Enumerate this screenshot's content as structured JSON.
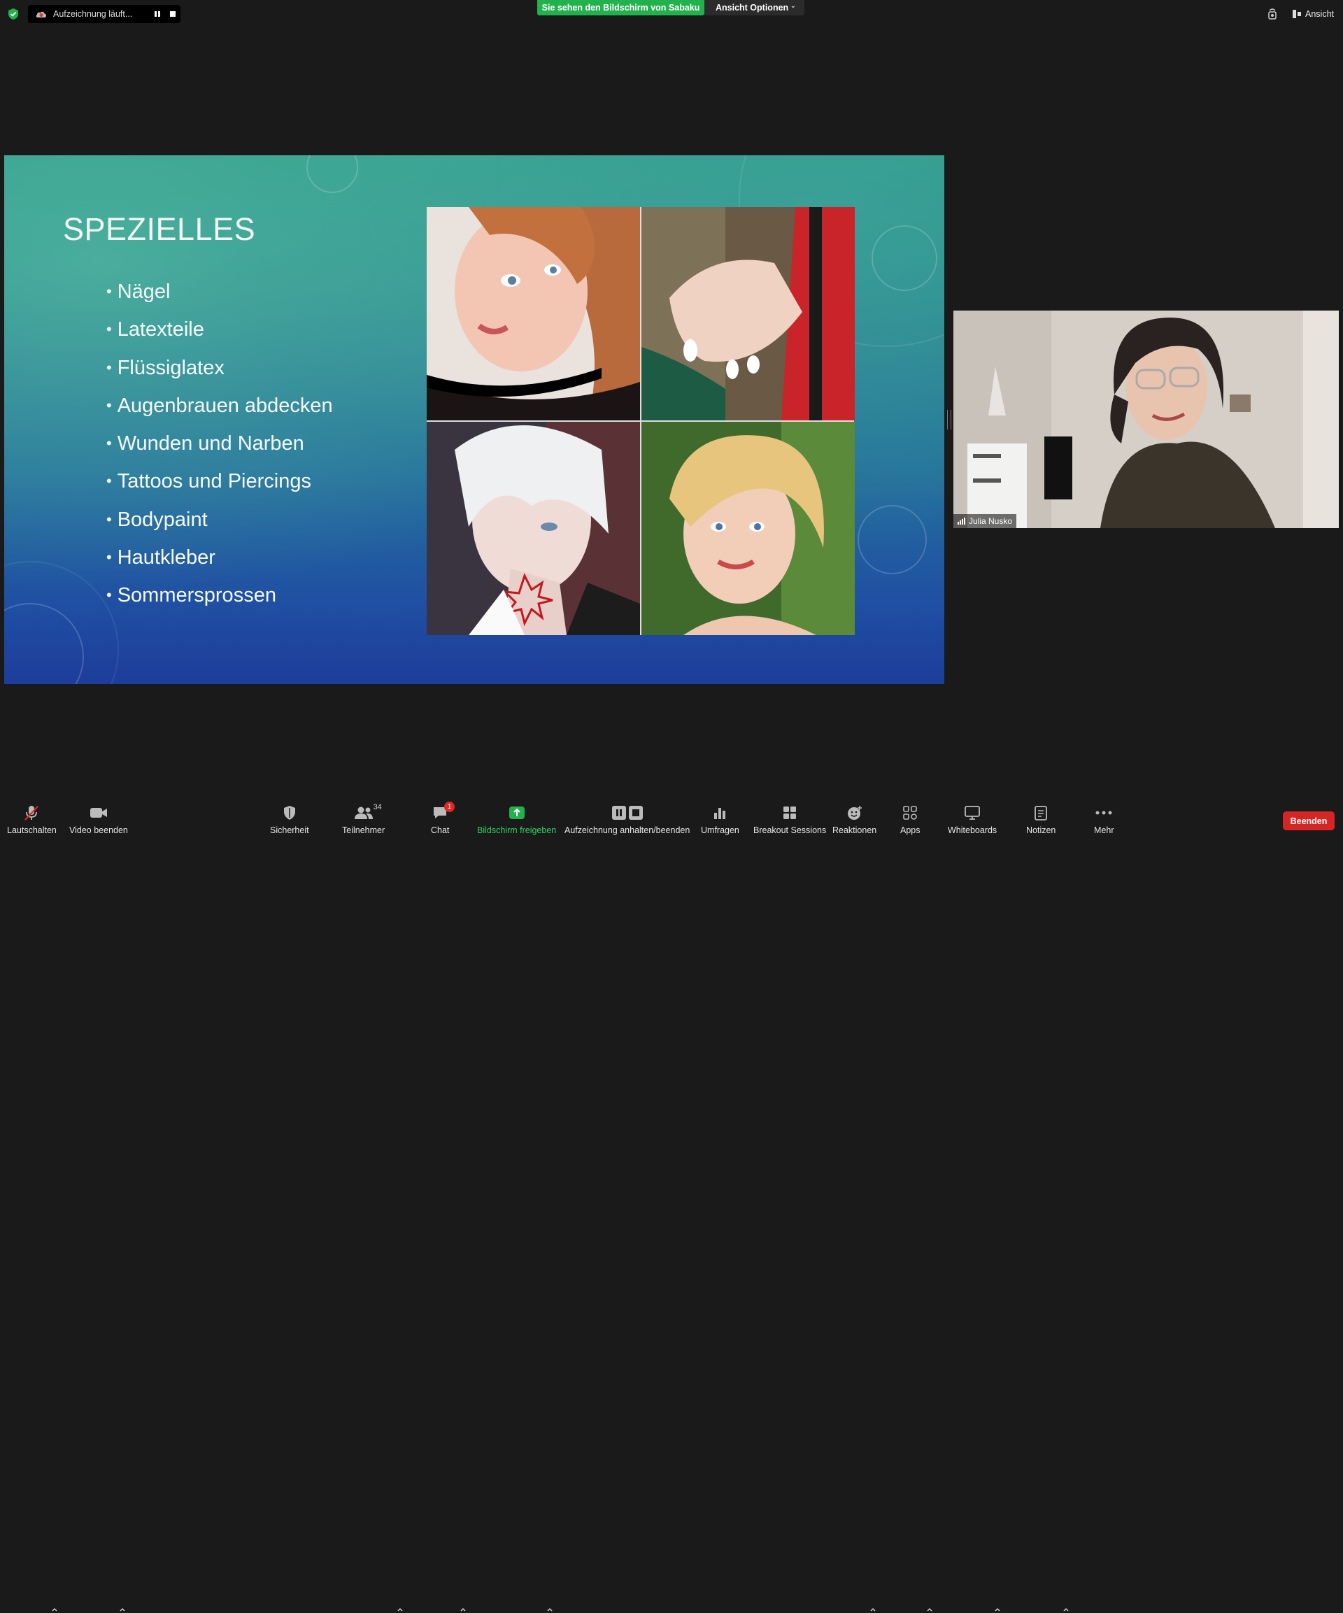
{
  "top_bar": {
    "recording_status": "Aufzeichnung läuft...",
    "viewing_banner": "Sie sehen den Bildschirm von Sabaku",
    "view_options_label": "Ansicht Optionen",
    "view_label": "Ansicht"
  },
  "slide": {
    "title": "SPEZIELLES",
    "bullets": [
      "Nägel",
      "Latexteile",
      "Flüssiglatex",
      "Augenbrauen abdecken",
      "Wunden und Narben",
      "Tattoos und Piercings",
      "Bodypaint",
      "Hautkleber",
      "Sommersprossen"
    ]
  },
  "participant_video": {
    "name": "Julia Nusko"
  },
  "toolbar": {
    "mute_label": "Lautschalten",
    "video_label": "Video beenden",
    "security_label": "Sicherheit",
    "participants_label": "Teilnehmer",
    "participants_count": "34",
    "chat_label": "Chat",
    "chat_badge": "1",
    "share_label": "Bildschirm freigeben",
    "recording_label": "Aufzeichnung anhalten/beenden",
    "polls_label": "Umfragen",
    "breakout_label": "Breakout Sessions",
    "reactions_label": "Reaktionen",
    "apps_label": "Apps",
    "whiteboards_label": "Whiteboards",
    "notes_label": "Notizen",
    "more_label": "Mehr",
    "end_label": "Beenden"
  },
  "colors": {
    "share_green": "#23b14d",
    "end_red": "#d62525",
    "background": "#1a1a1a"
  }
}
